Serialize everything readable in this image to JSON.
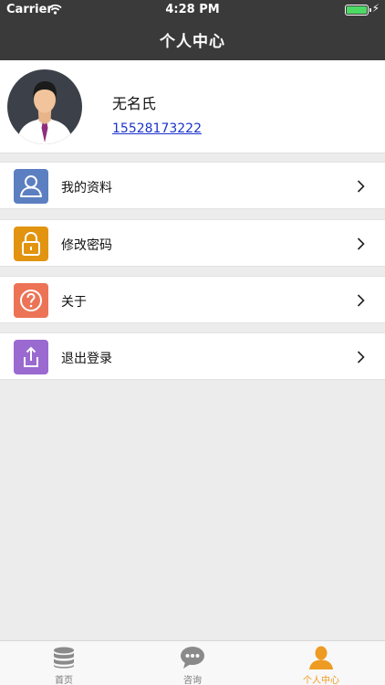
{
  "status_bar": {
    "carrier": "Carrier",
    "time": "4:28 PM"
  },
  "nav": {
    "title": "个人中心"
  },
  "profile": {
    "name": "无名氏",
    "phone": "15528173222"
  },
  "menu": [
    {
      "label": "我的资料",
      "icon": "user-profile-icon",
      "color": "#5b7fc1"
    },
    {
      "label": "修改密码",
      "icon": "lock-icon",
      "color": "#e29410"
    },
    {
      "label": "关于",
      "icon": "question-icon",
      "color": "#ec7356"
    },
    {
      "label": "退出登录",
      "icon": "logout-share-icon",
      "color": "#9a6ad0"
    }
  ],
  "tabs": [
    {
      "label": "首页",
      "icon": "database-icon",
      "active": false
    },
    {
      "label": "咨询",
      "icon": "chat-bubble-icon",
      "active": false
    },
    {
      "label": "个人中心",
      "icon": "person-icon",
      "active": true
    }
  ],
  "colors": {
    "nav_bg": "#3a3a3a",
    "accent": "#ee9b23",
    "page_bg": "#ececec"
  }
}
